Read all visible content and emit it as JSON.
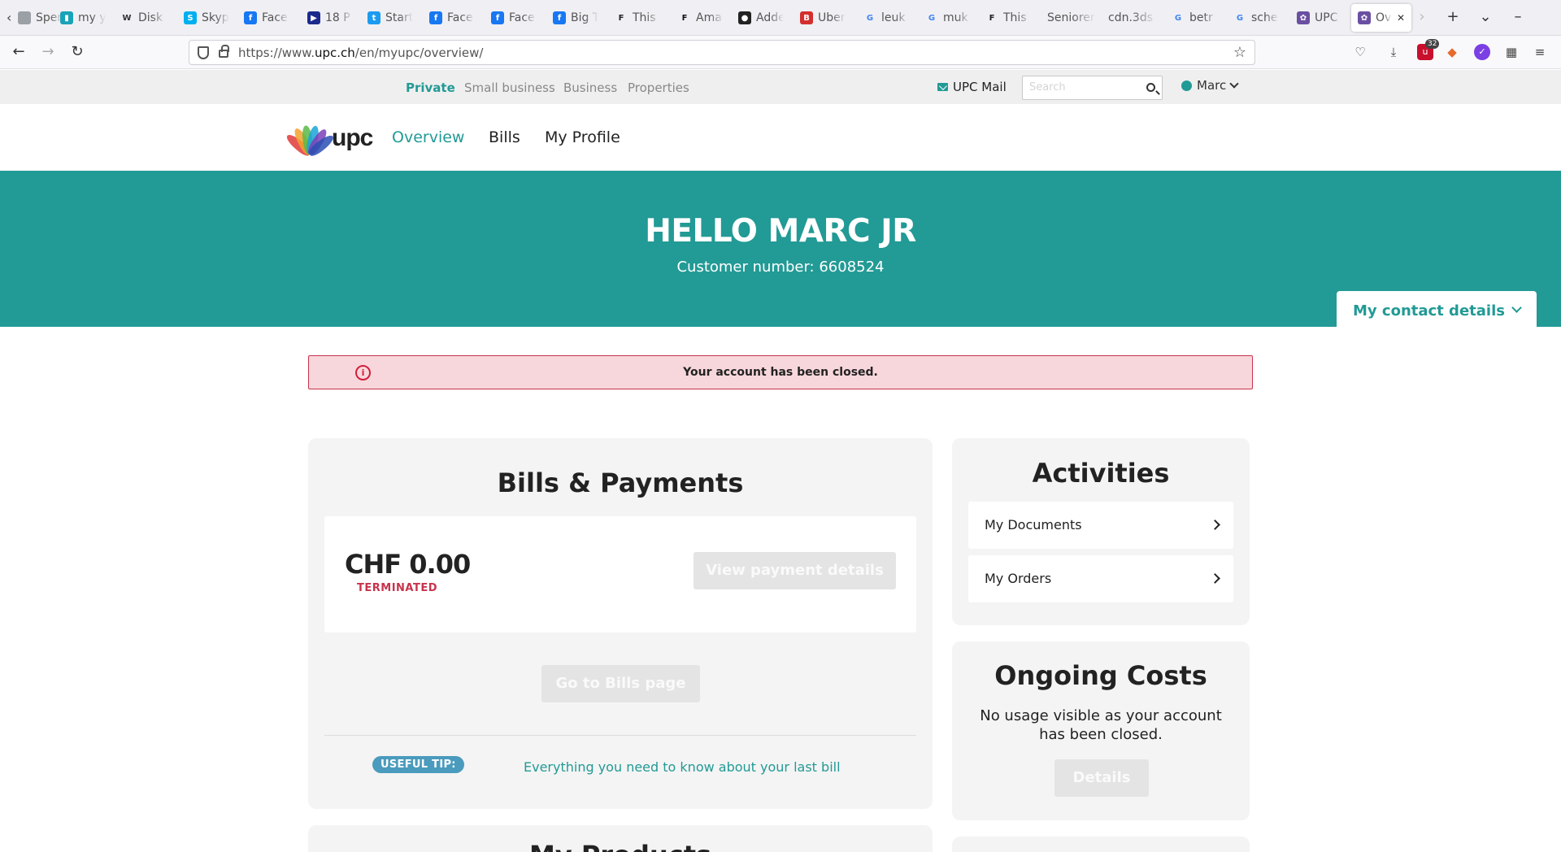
{
  "browser": {
    "tabs": [
      {
        "label": "Sper",
        "icon": "generic-page-icon",
        "color": "#9aa0a6"
      },
      {
        "label": "my y",
        "icon": "bar-chart-icon",
        "color": "#1aa3b8"
      },
      {
        "label": "Disk",
        "icon": "wikipedia-icon",
        "color": "#333333"
      },
      {
        "label": "Skyp",
        "icon": "skype-icon",
        "color": "#00aff0"
      },
      {
        "label": "Face",
        "icon": "facebook-icon",
        "color": "#1877f2"
      },
      {
        "label": "18 P",
        "icon": "play-icon",
        "color": "#1c2a8c"
      },
      {
        "label": "Start",
        "icon": "twitter-icon",
        "color": "#1d9bf0"
      },
      {
        "label": "Face",
        "icon": "facebook-icon",
        "color": "#1877f2"
      },
      {
        "label": "Face",
        "icon": "facebook-icon",
        "color": "#1877f2"
      },
      {
        "label": "Big T",
        "icon": "facebook-icon",
        "color": "#1877f2"
      },
      {
        "label": "This",
        "icon": "fx-icon",
        "color": "#222222"
      },
      {
        "label": "Ama",
        "icon": "f-icon",
        "color": "#111111"
      },
      {
        "label": "Adde",
        "icon": "github-icon",
        "color": "#222222"
      },
      {
        "label": "Über",
        "icon": "b-icon",
        "color": "#d32f2f"
      },
      {
        "label": "leuk",
        "icon": "google-icon",
        "color": "#4285f4"
      },
      {
        "label": "muk",
        "icon": "google-icon",
        "color": "#4285f4"
      },
      {
        "label": "This",
        "icon": "fx-icon",
        "color": "#222222"
      },
      {
        "label": "Seniorer",
        "icon": "none",
        "color": "#f0f0f4"
      },
      {
        "label": "cdn.3ds",
        "icon": "none",
        "color": "#f0f0f4"
      },
      {
        "label": "betr",
        "icon": "google-icon",
        "color": "#4285f4"
      },
      {
        "label": "sche",
        "icon": "google-icon",
        "color": "#4285f4"
      },
      {
        "label": "UPC",
        "icon": "upc-icon",
        "color": "#6a4fa3"
      },
      {
        "label": "Ov",
        "icon": "upc-icon",
        "color": "#6a4fa3"
      }
    ],
    "url_prefix": "https://www.",
    "url_domain": "upc.ch",
    "url_path": "/en/myupc/overview/",
    "extensions_badge": "32"
  },
  "utility": {
    "segments": [
      "Private",
      "Small business",
      "Business",
      "Properties"
    ],
    "mail_label": "UPC Mail",
    "search_placeholder": "Search",
    "user_name": "Marc"
  },
  "nav": {
    "logo_text": "upc",
    "items": [
      "Overview",
      "Bills",
      "My Profile"
    ]
  },
  "hero": {
    "greeting": "HELLO MARC JR",
    "customer_label": "Customer number: 6608524",
    "contact_details": "My contact details"
  },
  "alert": {
    "icon": "i",
    "message": "Your account has been closed."
  },
  "bills": {
    "title": "Bills & Payments",
    "amount": "CHF 0.00",
    "status": "TERMINATED",
    "view_button": "View payment details",
    "bills_button": "Go to Bills page",
    "tip_label": "USEFUL TIP:",
    "tip_link": "Everything you need to know about your last bill"
  },
  "activities": {
    "title": "Activities",
    "items": [
      "My Documents",
      "My Orders"
    ]
  },
  "ongoing": {
    "title": "Ongoing Costs",
    "text": "No usage visible as your account has been closed.",
    "details_button": "Details"
  },
  "products": {
    "title": "My Products"
  },
  "colors": {
    "brand_teal": "#229a95",
    "alert_bg": "#f8d7dc",
    "alert_border": "#c8334c",
    "terminated": "#c8334c",
    "tip_blue": "#4a9bbd"
  }
}
